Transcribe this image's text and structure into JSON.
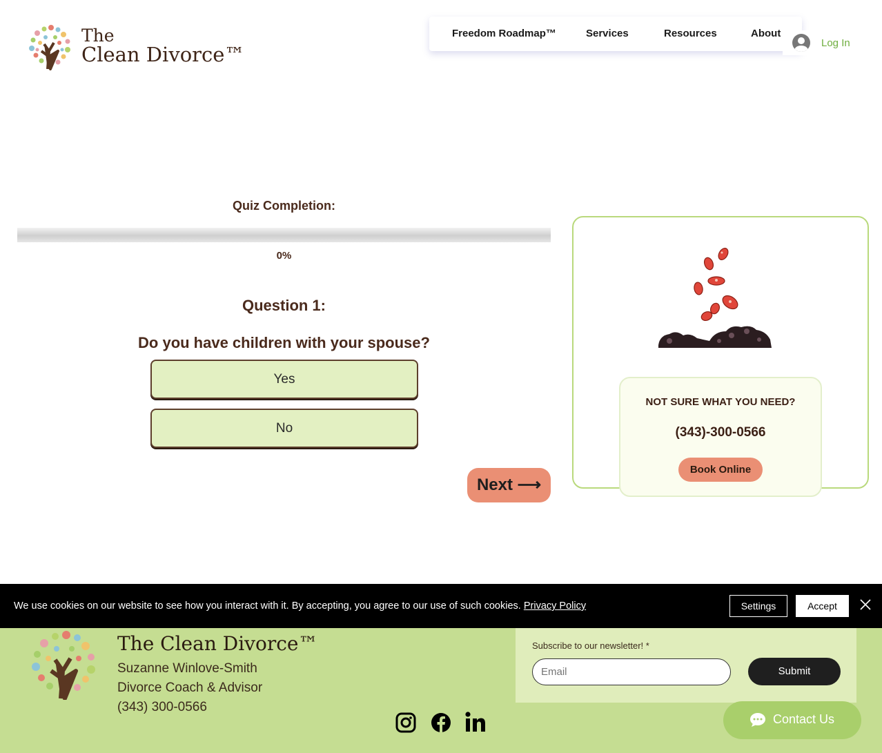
{
  "header": {
    "brand_the": "The",
    "brand_name": "Clean Divorce™",
    "nav": [
      "Freedom Roadmap™",
      "Services",
      "Resources",
      "About"
    ],
    "login_label": "Log In"
  },
  "quiz": {
    "completion_label": "Quiz Completion:",
    "progress_fraction": 0,
    "progress_percent_text": "0%",
    "question_number": "Question 1:",
    "question_text": "Do you have children with your spouse?",
    "answers": [
      "Yes",
      "No"
    ],
    "next_label": "Next ⟶"
  },
  "side_card": {
    "title": "NOT SURE WHAT YOU NEED?",
    "phone": "(343)-300-0566",
    "book_label": "Book Online"
  },
  "cookie": {
    "text": "We use cookies on our website to see how you interact with it. By accepting, you agree to our use of such cookies.",
    "link": "Privacy Policy",
    "settings_label": "Settings",
    "accept_label": "Accept"
  },
  "footer": {
    "brand": "The Clean Divorce™",
    "name": "Suzanne Winlove-Smith",
    "role": "Divorce Coach & Advisor",
    "phone": "(343) 300-0566",
    "newsletter_label": "Subscribe to our newsletter! *",
    "email_placeholder": "Email",
    "submit_label": "Submit",
    "social": [
      "instagram-icon",
      "facebook-icon",
      "linkedin-icon"
    ],
    "contact_label": "Contact Us"
  },
  "colors": {
    "accent_salmon": "#ea8f74",
    "answer_bg": "#e3f0c2",
    "card_border": "#b9d97c",
    "footer_bg": "#c5dd92",
    "text_brown": "#4a2a1c",
    "login_green": "#6fae3f"
  }
}
